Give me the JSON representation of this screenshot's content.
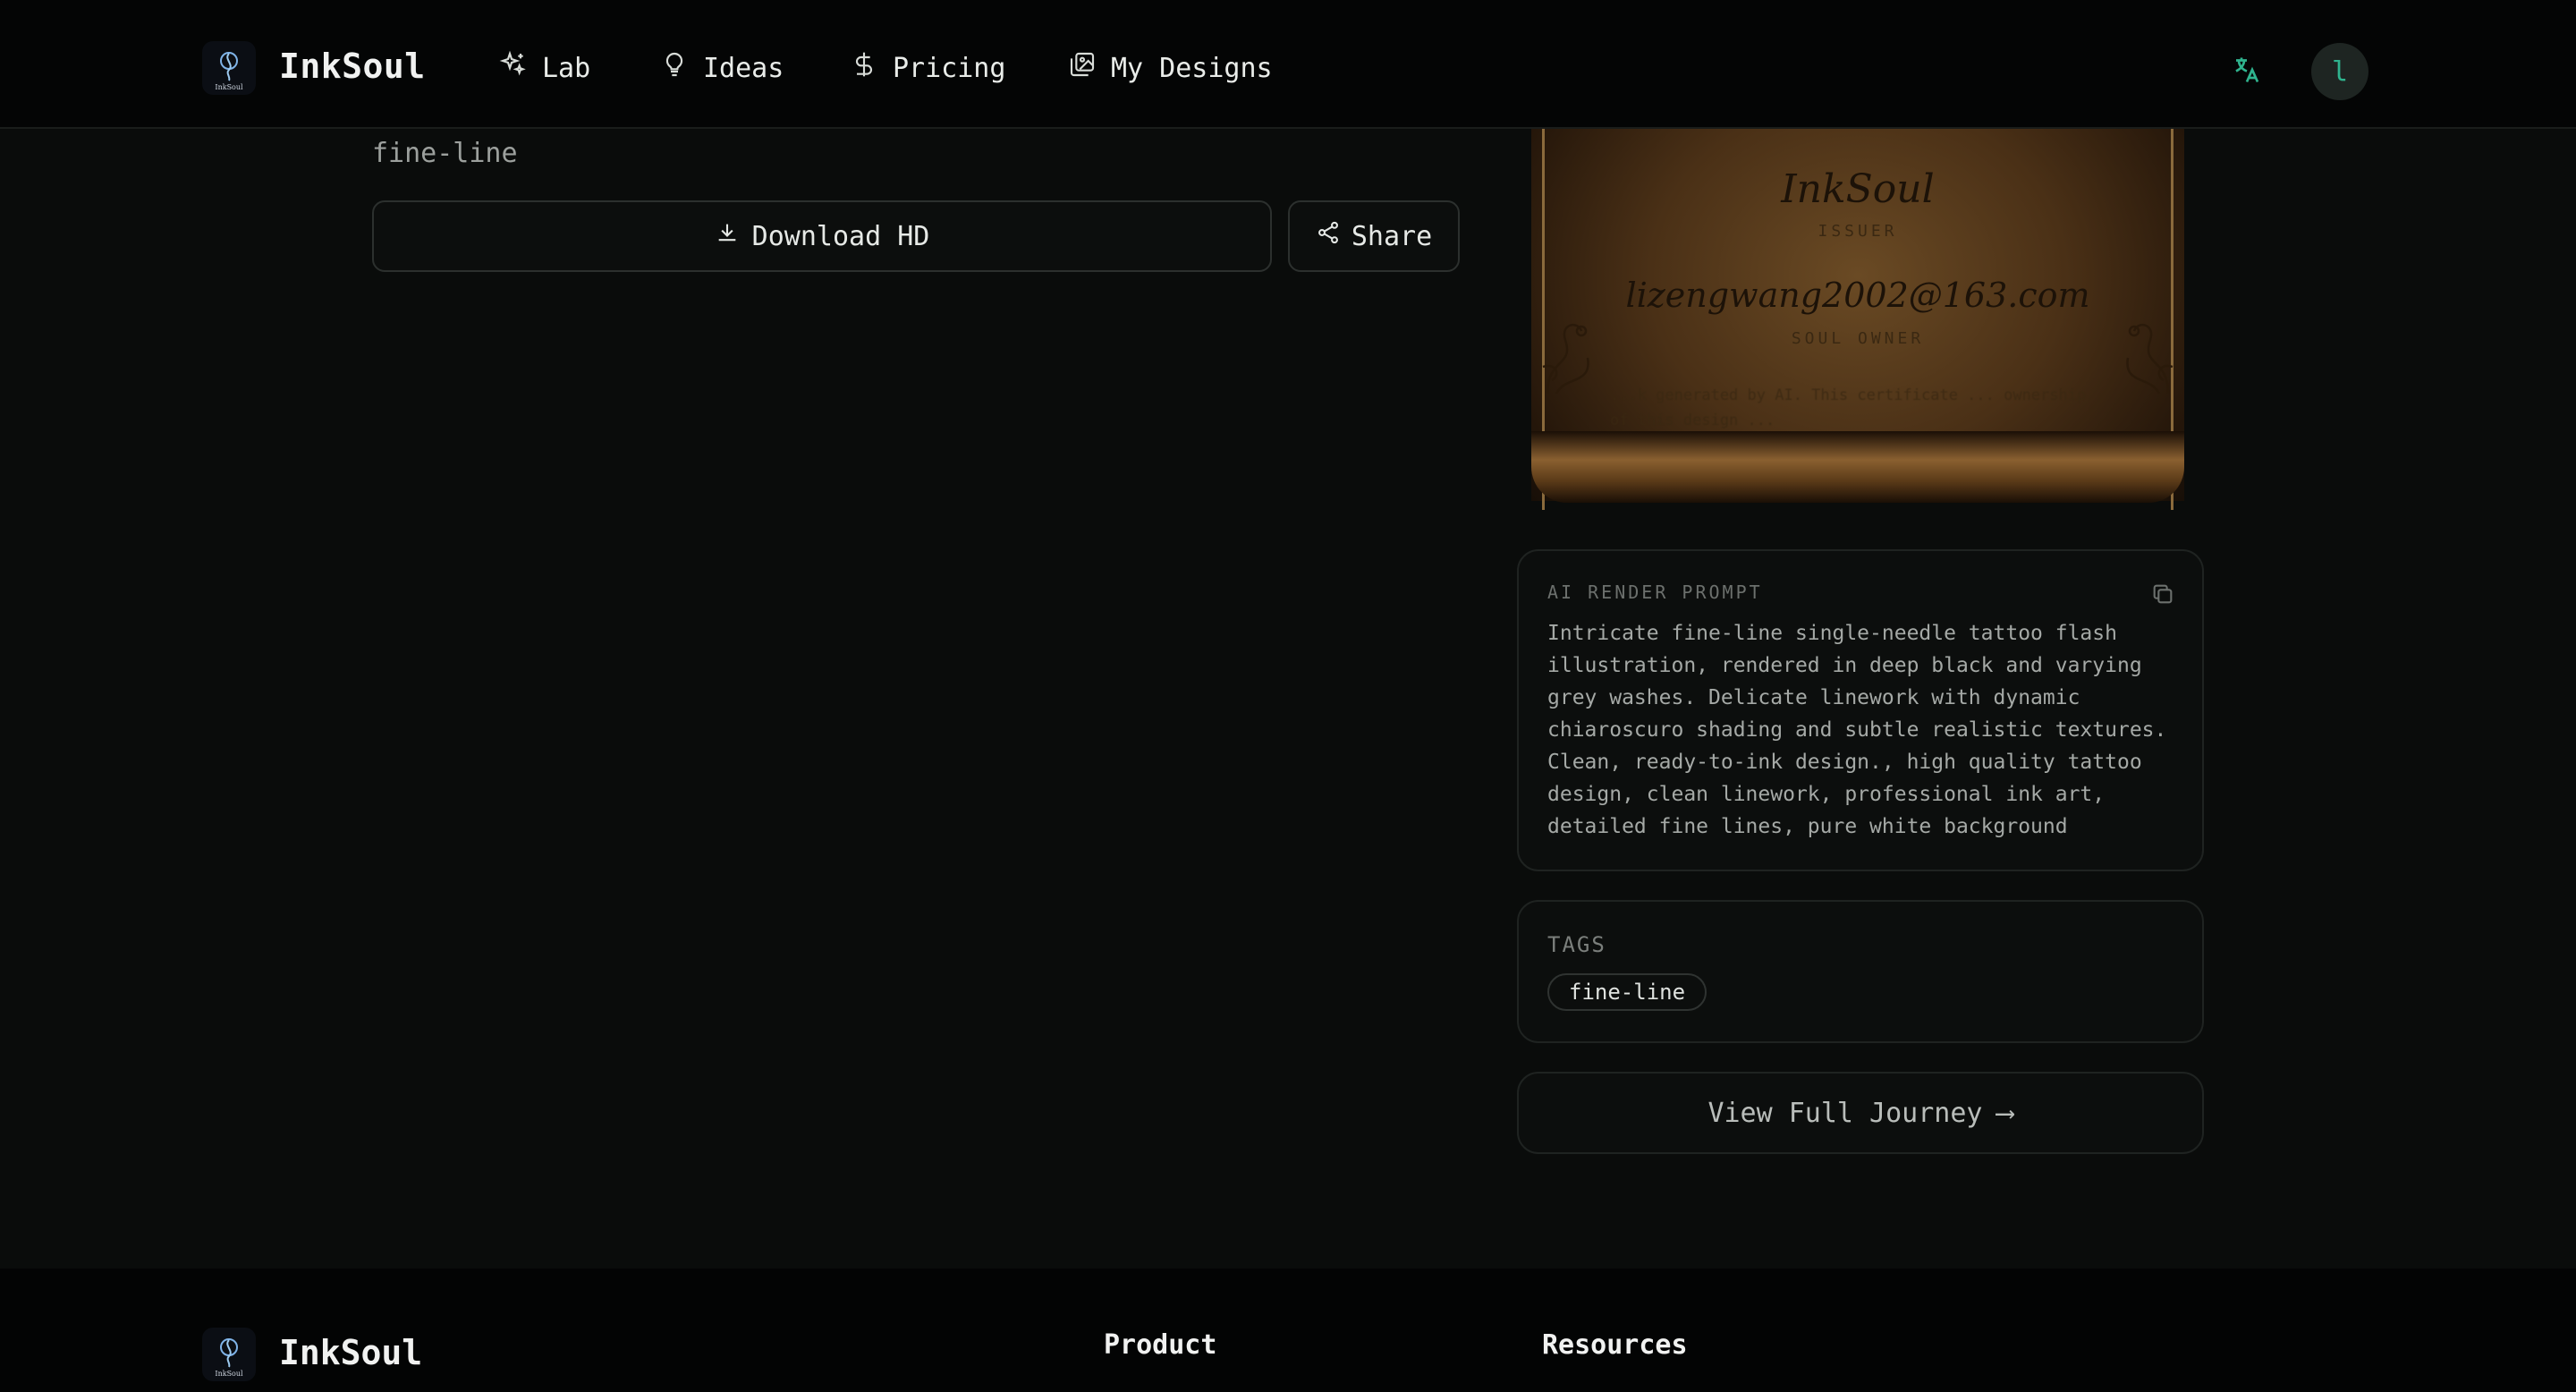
{
  "header": {
    "brand": "InkSoul",
    "logo_icon": "tattoo-logo-icon",
    "nav": [
      {
        "label": "Lab",
        "icon": "sparkles-icon"
      },
      {
        "label": "Ideas",
        "icon": "lightbulb-icon"
      },
      {
        "label": "Pricing",
        "icon": "dollar-icon"
      },
      {
        "label": "My Designs",
        "icon": "images-icon"
      }
    ],
    "translate_icon": "translate-icon",
    "avatar_initial": "l"
  },
  "design": {
    "style": "fine-line",
    "download_label": "Download HD",
    "share_label": "Share"
  },
  "certificate": {
    "issuer_name": "InkSoul",
    "issuer_label": "ISSUER",
    "owner_name": "lizengwang2002@163.com",
    "owner_label": "SOUL OWNER",
    "note": "...k generated by AI. This certificate ... ownership of this design ..."
  },
  "prompt": {
    "label": "AI RENDER PROMPT",
    "text": "Intricate fine-line single-needle tattoo flash illustration, rendered in deep black and varying grey washes. Delicate linework with dynamic chiaroscuro shading and subtle realistic textures. Clean, ready-to-ink design., high quality tattoo design, clean linework, professional ink art, detailed fine lines, pure white background"
  },
  "tags": {
    "label": "TAGS",
    "items": [
      "fine-line"
    ]
  },
  "journey": {
    "label": "View Full Journey",
    "arrow": "⟶"
  },
  "footer": {
    "brand": "InkSoul",
    "columns": [
      "Product",
      "Resources"
    ]
  },
  "colors": {
    "background": "#0a0c0b",
    "accent": "#2fb38e",
    "parchment": "#6a4a24"
  }
}
